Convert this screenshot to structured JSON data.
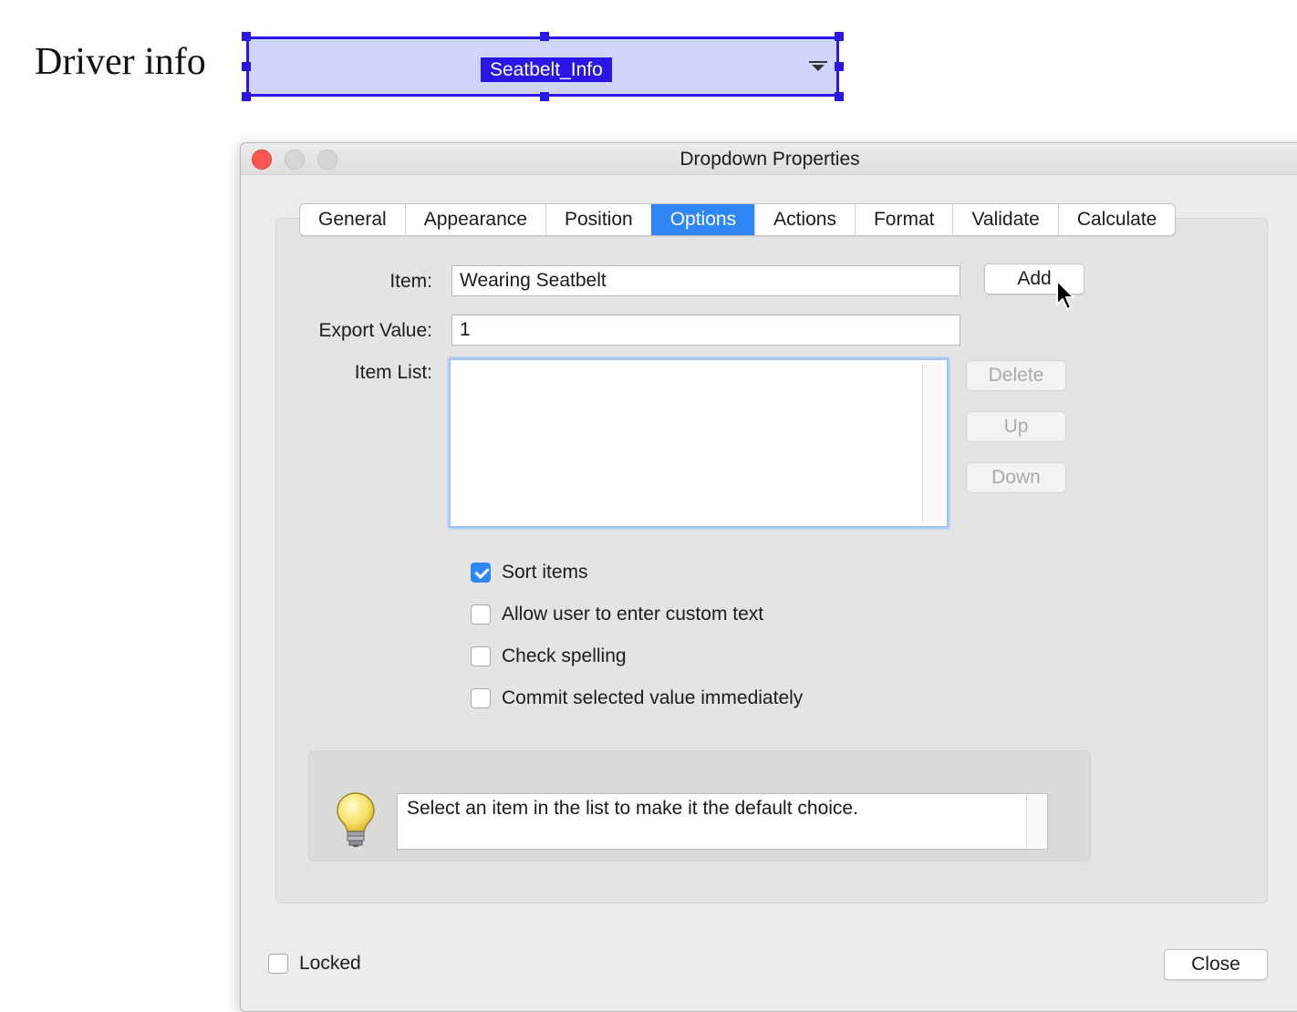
{
  "page": {
    "label": "Driver info"
  },
  "field": {
    "name": "Seatbelt_Info"
  },
  "dialog": {
    "title": "Dropdown Properties",
    "tabs": [
      {
        "label": "General"
      },
      {
        "label": "Appearance"
      },
      {
        "label": "Position"
      },
      {
        "label": "Options",
        "active": true
      },
      {
        "label": "Actions"
      },
      {
        "label": "Format"
      },
      {
        "label": "Validate"
      },
      {
        "label": "Calculate"
      }
    ],
    "options": {
      "item_label": "Item:",
      "item_value": "Wearing Seatbelt",
      "export_label": "Export Value:",
      "export_value": "1",
      "item_list_label": "Item List:",
      "add_button": "Add",
      "delete_button": "Delete",
      "up_button": "Up",
      "down_button": "Down",
      "checkboxes": [
        {
          "label": "Sort items",
          "checked": true
        },
        {
          "label": "Allow user to enter custom text",
          "checked": false
        },
        {
          "label": "Check spelling",
          "checked": false
        },
        {
          "label": "Commit selected value immediately",
          "checked": false
        }
      ],
      "hint": "Select an item in the list to make it the default choice.",
      "hint_icon": "lightbulb-icon"
    },
    "footer": {
      "locked_label": "Locked",
      "locked_checked": false,
      "close_button": "Close"
    }
  },
  "colors": {
    "accent": "#2f86f6",
    "selection": "#2a16e6",
    "field_fill": "#cfd5fb",
    "close_light": "#fc5753"
  }
}
